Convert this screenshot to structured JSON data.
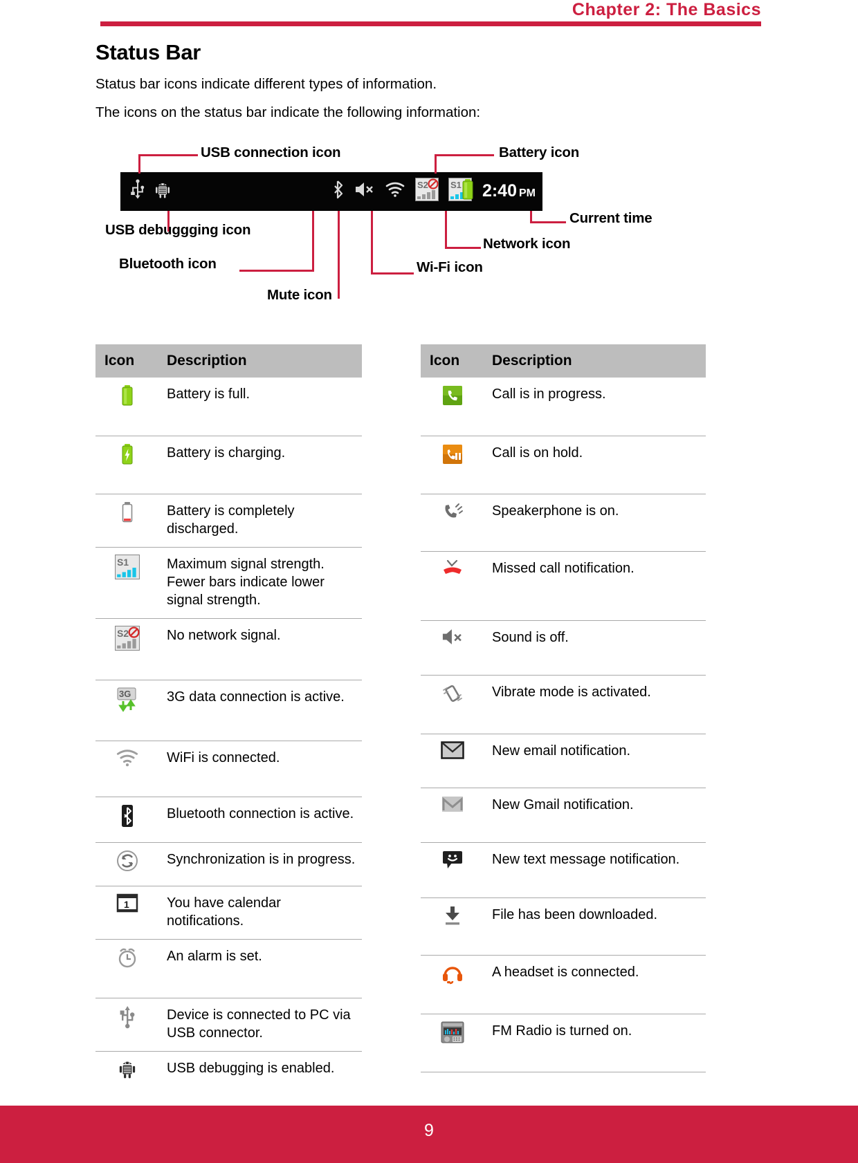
{
  "header": {
    "chapter_title": "Chapter 2: The Basics",
    "rule_color": "#cc1f40"
  },
  "section": {
    "title": "Status Bar",
    "paragraph_1": "Status bar icons indicate different types of information.",
    "paragraph_2": "The icons on the status bar indicate the following information:"
  },
  "diagram": {
    "status_bar_time": "2:40",
    "status_bar_ampm": "PM",
    "callouts": {
      "usb_connection": "USB connection icon",
      "battery": "Battery icon",
      "usb_debugging": "USB debuggging icon",
      "bluetooth": "Bluetooth icon",
      "mute": "Mute icon",
      "wifi": "Wi-Fi icon",
      "network": "Network icon",
      "current_time": "Current time"
    },
    "bar_icons": [
      "usb-icon",
      "android-bug-icon",
      "bluetooth-icon",
      "mute-speaker-icon",
      "wifi-icon",
      "no-network-signal-icon",
      "signal-strength-icon",
      "battery-full-icon",
      "clock-time"
    ]
  },
  "table_left": {
    "headers": {
      "icon": "Icon",
      "description": "Description"
    },
    "rows": [
      {
        "icon": "battery-full-icon",
        "description": "Battery is full."
      },
      {
        "icon": "battery-charging-icon",
        "description": "Battery is charging."
      },
      {
        "icon": "battery-empty-icon",
        "description": "Battery is completely discharged."
      },
      {
        "icon": "signal-strength-icon",
        "description": "Maximum signal strength. Fewer bars indicate lower signal strength."
      },
      {
        "icon": "no-network-signal-icon",
        "description": "No network signal."
      },
      {
        "icon": "3g-data-icon",
        "description": "3G data connection is active."
      },
      {
        "icon": "wifi-icon",
        "description": "WiFi is connected."
      },
      {
        "icon": "bluetooth-icon",
        "description": "Bluetooth connection is active."
      },
      {
        "icon": "sync-icon",
        "description": "Synchronization is in progress."
      },
      {
        "icon": "calendar-icon",
        "description": "You have calendar notifications."
      },
      {
        "icon": "alarm-clock-icon",
        "description": "An alarm is set."
      },
      {
        "icon": "usb-connector-icon",
        "description": "Device is connected to PC via USB connector."
      },
      {
        "icon": "android-bug-icon",
        "description": "USB debugging is enabled."
      }
    ]
  },
  "table_right": {
    "headers": {
      "icon": "Icon",
      "description": "Description"
    },
    "rows": [
      {
        "icon": "call-in-progress-icon",
        "description": "Call is in progress."
      },
      {
        "icon": "call-on-hold-icon",
        "description": "Call is on hold."
      },
      {
        "icon": "speakerphone-icon",
        "description": "Speakerphone is on."
      },
      {
        "icon": "missed-call-icon",
        "description": "Missed call notification."
      },
      {
        "icon": "mute-speaker-icon",
        "description": "Sound is off."
      },
      {
        "icon": "vibrate-icon",
        "description": "Vibrate mode is activated."
      },
      {
        "icon": "email-icon",
        "description": "New email notification."
      },
      {
        "icon": "gmail-icon",
        "description": "New Gmail notification."
      },
      {
        "icon": "sms-icon",
        "description": "New text message notification."
      },
      {
        "icon": "download-icon",
        "description": "File has been downloaded."
      },
      {
        "icon": "headset-icon",
        "description": "A headset is connected."
      },
      {
        "icon": "fm-radio-icon",
        "description": "FM Radio is turned on."
      }
    ]
  },
  "footer": {
    "page_number": "9",
    "band_color": "#cc1f40"
  }
}
